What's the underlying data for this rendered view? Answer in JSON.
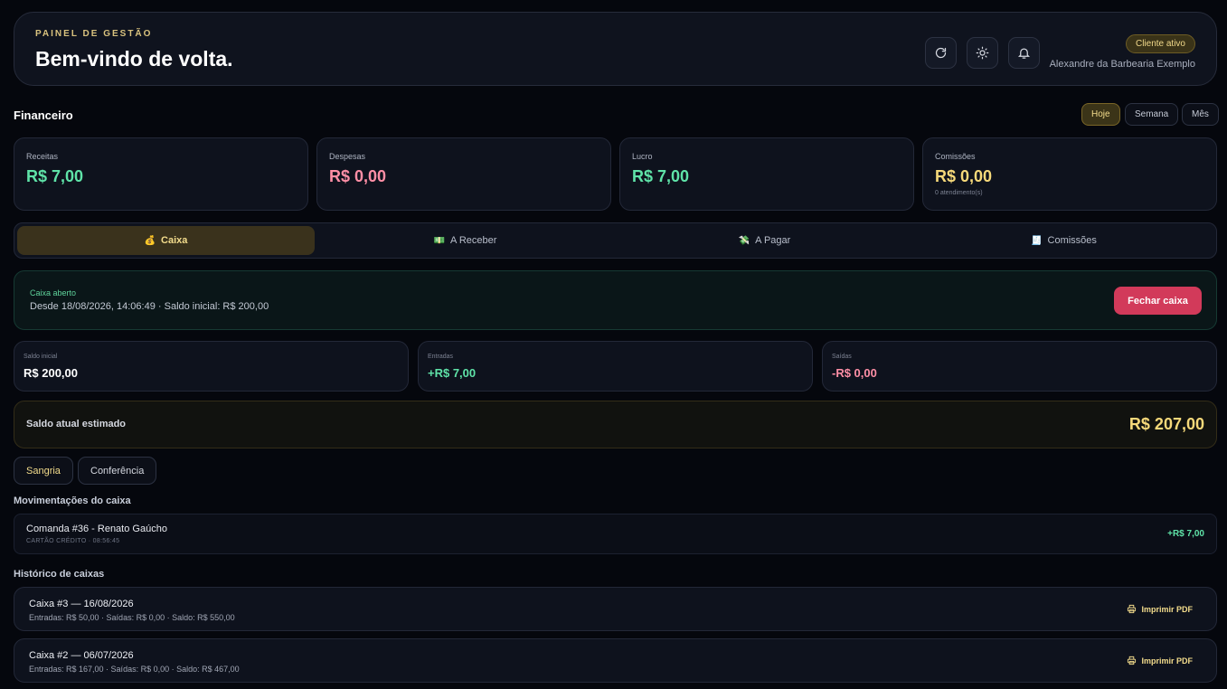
{
  "header": {
    "eyebrow": "PAINEL DE GESTÃO",
    "title": "Bem-vindo de volta.",
    "icons": [
      "refresh-icon",
      "sun-icon",
      "bell-icon"
    ],
    "badge": "Cliente ativo",
    "user": "Alexandre da Barbearia Exemplo"
  },
  "financeiro": {
    "title": "Financeiro",
    "ranges": [
      "Hoje",
      "Semana",
      "Mês"
    ],
    "active_range": "Hoje",
    "stats": [
      {
        "label": "Receitas",
        "value": "R$ 7,00",
        "color": "#5fe3a8"
      },
      {
        "label": "Despesas",
        "value": "R$ 0,00",
        "color": "#ff8fa6"
      },
      {
        "label": "Lucro",
        "value": "R$ 7,00",
        "color": "#5fe3a8"
      },
      {
        "label": "Comissões",
        "value": "R$ 0,00",
        "sub": "0 atendimento(s)",
        "color": "#f6d97a"
      }
    ]
  },
  "tabs": [
    {
      "label": "Caixa",
      "glyph": "💰",
      "active": true
    },
    {
      "label": "A Receber",
      "glyph": "💵"
    },
    {
      "label": "A Pagar",
      "glyph": "💸"
    },
    {
      "label": "Comissões",
      "glyph": "🧾"
    }
  ],
  "caixa": {
    "status_label": "Caixa aberto",
    "status_desc": "Desde 18/08/2026, 14:06:49 · Saldo inicial: R$ 200,00",
    "close_label": "Fechar caixa",
    "summary": [
      {
        "label": "Saldo inicial",
        "value": "R$ 200,00"
      },
      {
        "label": "Entradas",
        "value": "+R$ 7,00"
      },
      {
        "label": "Saídas",
        "value": "-R$ 0,00"
      }
    ],
    "balance_label": "Saldo atual estimado",
    "balance_value": "R$ 207,00",
    "actions": [
      "Sangria",
      "Conferência"
    ],
    "movements_title": "Movimentações do caixa",
    "movements": [
      {
        "title": "Comanda #36 - Renato Gaúcho",
        "sub": "CARTÃO CRÉDITO · 08:56:45",
        "value": "+R$ 7,00"
      }
    ],
    "history_title": "Histórico de caixas",
    "history": [
      {
        "title": "Caixa #3 — 16/08/2026",
        "sub": "Entradas: R$ 50,00 · Saídas: R$ 0,00 · Saldo: R$ 550,00",
        "action": "Imprimir PDF"
      },
      {
        "title": "Caixa #2 — 06/07/2026",
        "sub": "Entradas: R$ 167,00 · Saídas: R$ 0,00 · Saldo: R$ 467,00",
        "action": "Imprimir PDF"
      }
    ]
  }
}
